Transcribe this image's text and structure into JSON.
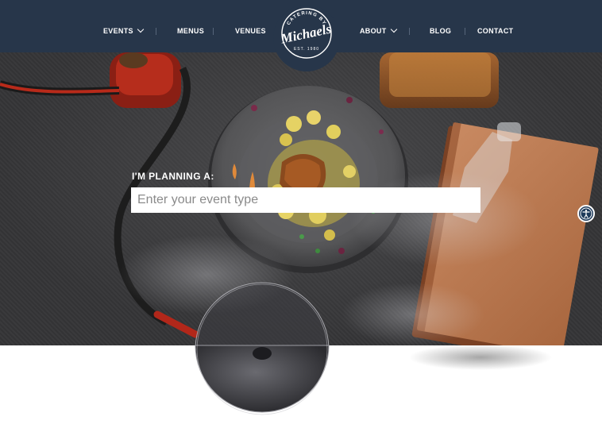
{
  "nav": {
    "items": [
      {
        "label": "EVENTS",
        "has_dropdown": true
      },
      {
        "label": "MENUS",
        "has_dropdown": false
      },
      {
        "label": "VENUES",
        "has_dropdown": false
      },
      {
        "label": "ABOUT",
        "has_dropdown": true
      },
      {
        "label": "BLOG",
        "has_dropdown": false
      },
      {
        "label": "CONTACT",
        "has_dropdown": false
      }
    ]
  },
  "logo": {
    "top_text": "CATERING BY",
    "name": "Michaels",
    "est": "EST. 1980"
  },
  "hero": {
    "planning_label": "I'M PLANNING A:",
    "input_placeholder": "Enter your event type"
  },
  "colors": {
    "header_bg": "#27364a",
    "nav_text": "#ffffff",
    "input_bg": "#ffffff",
    "accessibility_button": "#1e3a5a"
  },
  "icons": {
    "accessibility": "accessibility-icon",
    "dropdown": "chevron-down-icon"
  }
}
